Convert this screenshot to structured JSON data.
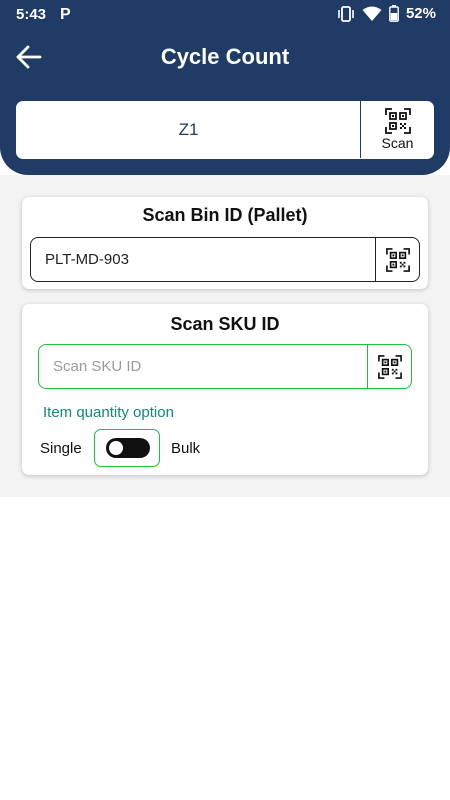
{
  "status_bar": {
    "time": "5:43",
    "app_icon": "P",
    "battery_percent": "52%",
    "icons": [
      "vibrate-icon",
      "wifi-icon",
      "battery-icon"
    ]
  },
  "header": {
    "title": "Cycle Count",
    "back_icon": "arrow-left-icon",
    "color": "#1f3b66"
  },
  "zone": {
    "value": "Z1",
    "scan_label": "Scan",
    "scan_icon": "qr-scan-icon"
  },
  "bin_card": {
    "title": "Scan Bin ID (Pallet)",
    "input_value": "PLT-MD-903",
    "scan_icon": "qr-scan-icon"
  },
  "sku_card": {
    "title": "Scan SKU ID",
    "input_placeholder": "Scan SKU ID",
    "scan_icon": "qr-scan-icon",
    "quantity_option_label": "Item quantity option",
    "single_label": "Single",
    "bulk_label": "Bulk",
    "toggle_state": "off",
    "accent_color": "#1ec13b"
  }
}
